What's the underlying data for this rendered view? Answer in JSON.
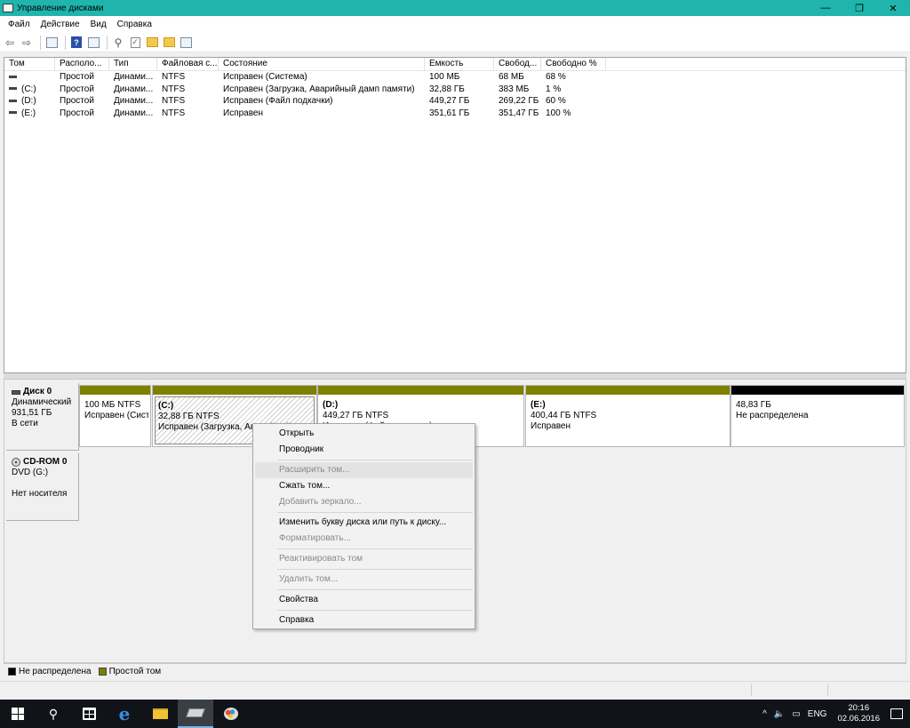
{
  "window": {
    "title": "Управление дисками",
    "minimize": "—",
    "maximize": "❐",
    "close": "✕"
  },
  "menu": [
    "Файл",
    "Действие",
    "Вид",
    "Справка"
  ],
  "toolbar_icons": [
    "back-arrow-icon",
    "forward-arrow-icon",
    "console-icon",
    "help-icon",
    "properties-icon",
    "connect-icon",
    "check-icon",
    "folder-up-icon",
    "folder-search-icon",
    "list-icon"
  ],
  "volumes": {
    "headers": [
      "Том",
      "Располо...",
      "Тип",
      "Файловая с...",
      "Состояние",
      "Емкость",
      "Свобод...",
      "Свободно %"
    ],
    "rows": [
      [
        "",
        "Простой",
        "Динами...",
        "NTFS",
        "Исправен (Система)",
        "100 МБ",
        "68 МБ",
        "68 %"
      ],
      [
        "(C:)",
        "Простой",
        "Динами...",
        "NTFS",
        "Исправен (Загрузка, Аварийный дамп памяти)",
        "32,88 ГБ",
        "383 МБ",
        "1 %"
      ],
      [
        "(D:)",
        "Простой",
        "Динами...",
        "NTFS",
        "Исправен (Файл подкачки)",
        "449,27 ГБ",
        "269,22 ГБ",
        "60 %"
      ],
      [
        "(E:)",
        "Простой",
        "Динами...",
        "NTFS",
        "Исправен",
        "351,61 ГБ",
        "351,47 ГБ",
        "100 %"
      ]
    ]
  },
  "disk0": {
    "name": "Диск 0",
    "type": "Динамический",
    "size": "931,51 ГБ",
    "status": "В сети",
    "partitions": [
      {
        "label": "",
        "size": "100 МБ NTFS",
        "status": "Исправен (Сист",
        "color": "#7f7f00"
      },
      {
        "label": "(C:)",
        "size": "32,88 ГБ NTFS",
        "status": "Исправен (Загрузка, Аварийный дамп памяти)",
        "color": "#7f7f00"
      },
      {
        "label": "(D:)",
        "size": "449,27 ГБ NTFS",
        "status": "Исправен (Файл подкачки)",
        "color": "#7f7f00"
      },
      {
        "label": "(E:)",
        "size": "400,44 ГБ NTFS",
        "status": "Исправен",
        "color": "#7f7f00"
      },
      {
        "label": "",
        "size": "48,83 ГБ",
        "status": "Не распределена",
        "color": "#000000"
      }
    ]
  },
  "cdrom0": {
    "name": "CD-ROM 0",
    "drive": "DVD (G:)",
    "status": "Нет носителя"
  },
  "context_menu": [
    {
      "label": "Открыть",
      "enabled": true
    },
    {
      "label": "Проводник",
      "enabled": true
    },
    {
      "label": "Расширить том...",
      "enabled": false
    },
    {
      "label": "Сжать том...",
      "enabled": true
    },
    {
      "label": "Добавить зеркало...",
      "enabled": false
    },
    {
      "label": "Изменить букву диска или путь к диску...",
      "enabled": true
    },
    {
      "label": "Форматировать...",
      "enabled": false
    },
    {
      "label": "Реактивировать том",
      "enabled": false
    },
    {
      "label": "Удалить том...",
      "enabled": false
    },
    {
      "label": "Свойства",
      "enabled": true
    },
    {
      "label": "Справка",
      "enabled": true
    }
  ],
  "legend": [
    {
      "label": "Не распределена",
      "color": "#000000"
    },
    {
      "label": "Простой том",
      "color": "#7f7f00"
    }
  ],
  "taskbar": {
    "apps": [
      "start-icon",
      "search-icon",
      "store-icon",
      "edge-icon",
      "explorer-icon",
      "disk-management-icon",
      "paint-icon"
    ],
    "tray_chevron": "^",
    "volume_icon": "🔈",
    "lang": "ENG",
    "time": "20:16",
    "date": "02.06.2016"
  }
}
